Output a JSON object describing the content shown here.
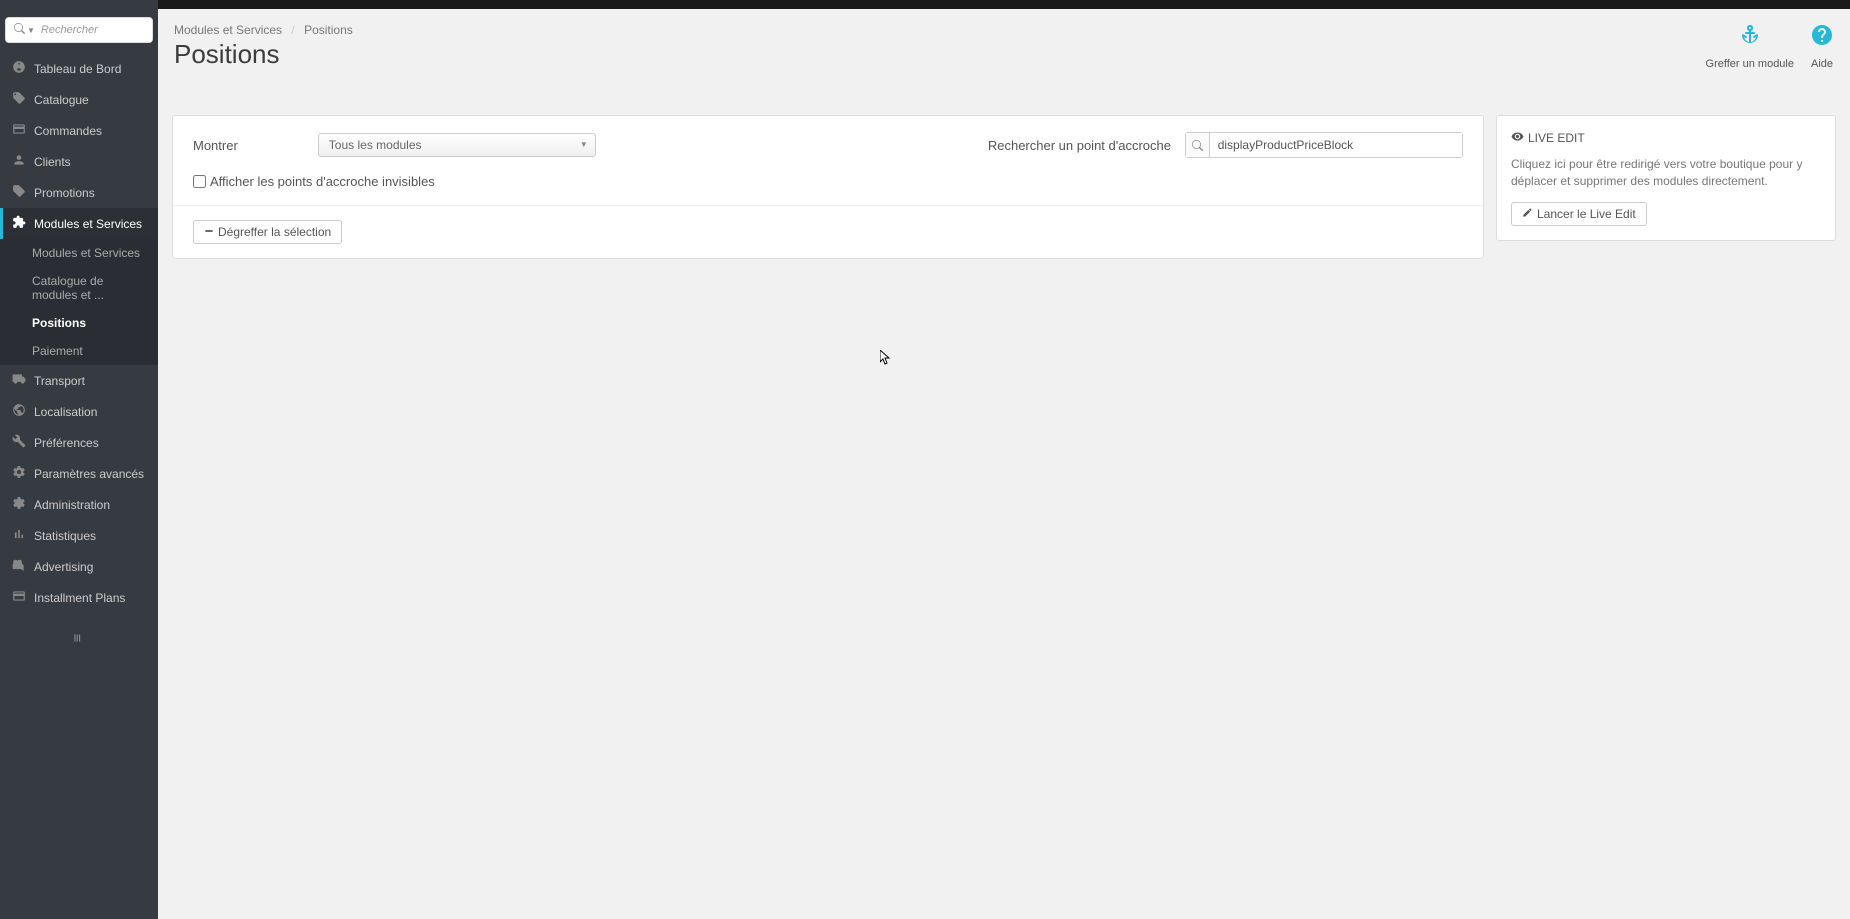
{
  "search": {
    "placeholder": "Rechercher"
  },
  "sidebar": {
    "items": [
      {
        "icon": "tachometer",
        "label": "Tableau de Bord"
      },
      {
        "icon": "tags",
        "label": "Catalogue"
      },
      {
        "icon": "credit-card",
        "label": "Commandes"
      },
      {
        "icon": "user",
        "label": "Clients"
      },
      {
        "icon": "tag",
        "label": "Promotions"
      },
      {
        "icon": "puzzle",
        "label": "Modules et Services"
      },
      {
        "icon": "truck",
        "label": "Transport"
      },
      {
        "icon": "globe",
        "label": "Localisation"
      },
      {
        "icon": "wrench",
        "label": "Préférences"
      },
      {
        "icon": "cogs",
        "label": "Paramètres avancés"
      },
      {
        "icon": "cog",
        "label": "Administration"
      },
      {
        "icon": "bar-chart",
        "label": "Statistiques"
      },
      {
        "icon": "bullhorn",
        "label": "Advertising"
      },
      {
        "icon": "credit-card",
        "label": "Installment Plans"
      }
    ],
    "subitems": [
      {
        "label": "Modules et Services"
      },
      {
        "label": "Catalogue de modules et ..."
      },
      {
        "label": "Positions"
      },
      {
        "label": "Paiement"
      }
    ]
  },
  "breadcrumb": {
    "parent": "Modules et Services",
    "current": "Positions"
  },
  "page": {
    "title": "Positions"
  },
  "actions": {
    "hook_label": "Greffer un module",
    "help_label": "Aide"
  },
  "filters": {
    "show_label": "Montrer",
    "show_value": "Tous les modules",
    "search_hook_label": "Rechercher un point d'accroche",
    "search_hook_value": "displayProductPriceBlock",
    "invisible_label": "Afficher les points d'accroche invisibles",
    "unhook_label": "Dégreffer la sélection"
  },
  "liveedit": {
    "title": "LIVE EDIT",
    "desc": "Cliquez ici pour être redirigé vers votre boutique pour y déplacer et supprimer des modules directement.",
    "button": "Lancer le Live Edit"
  }
}
